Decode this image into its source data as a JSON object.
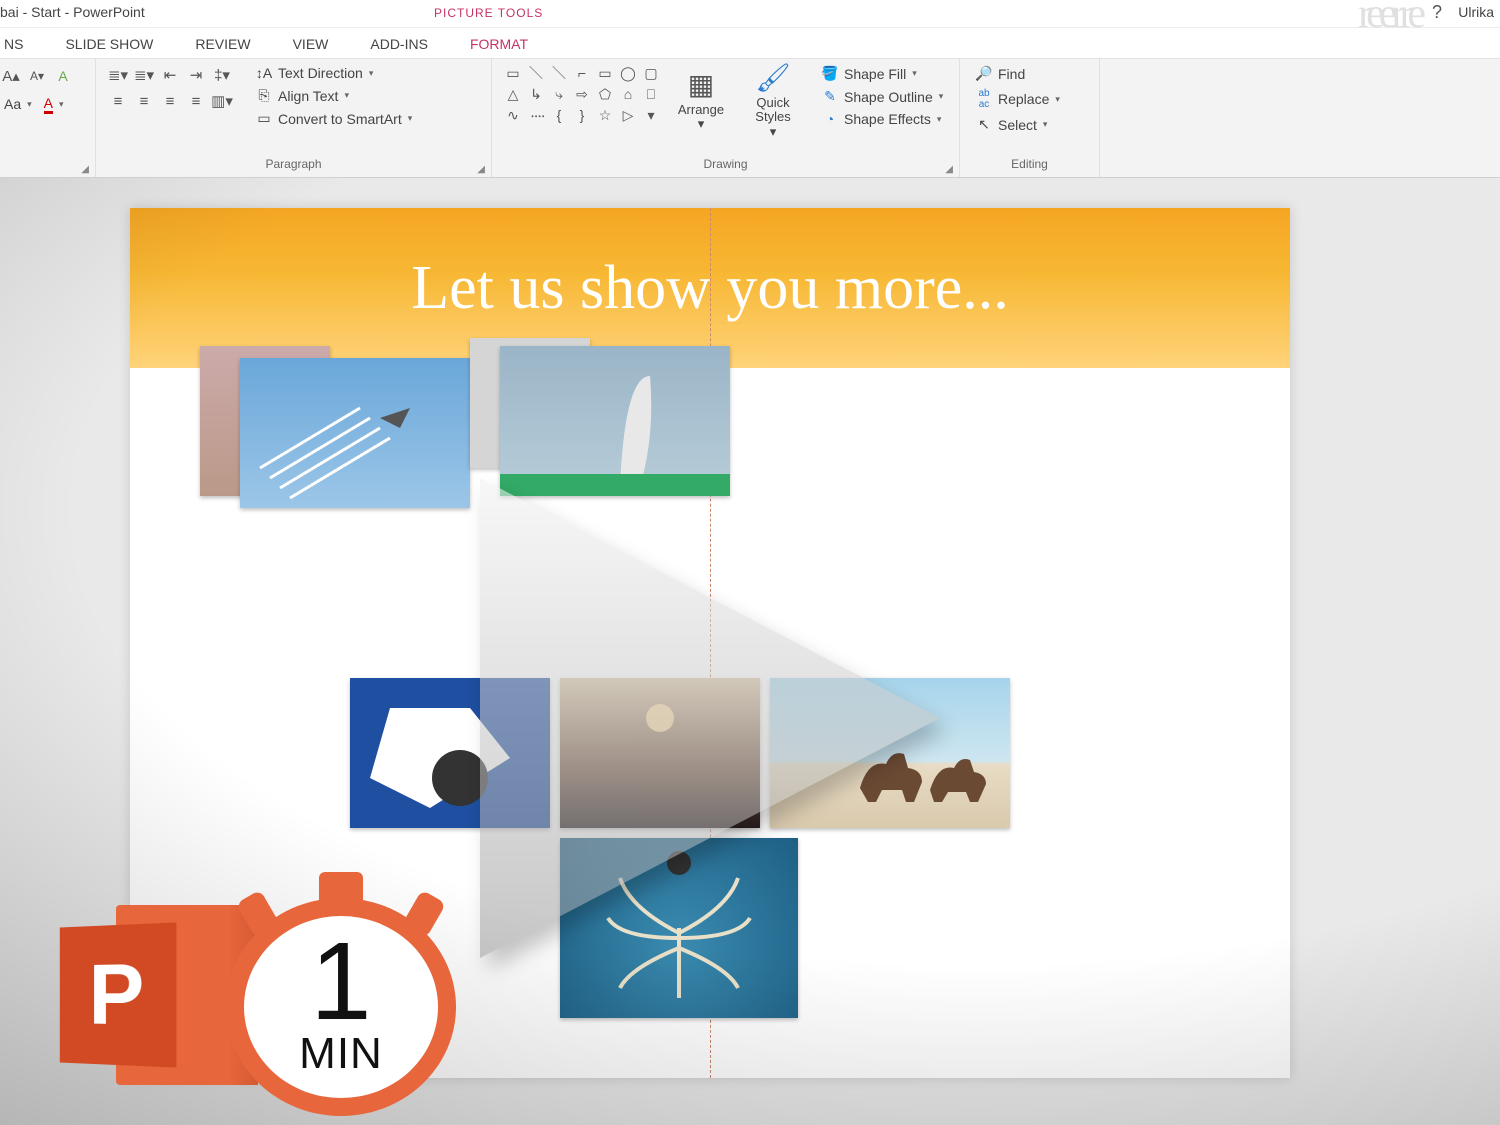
{
  "title_bar": {
    "document_title": "bai - Start - PowerPoint",
    "contextual_tab_group": "PICTURE TOOLS",
    "help_symbol": "?",
    "user_name": "Ulrika"
  },
  "tabs": {
    "items": [
      "NS",
      "SLIDE SHOW",
      "REVIEW",
      "VIEW",
      "ADD-INS",
      "FORMAT"
    ]
  },
  "ribbon": {
    "font": {
      "grow": "A",
      "shrink": "A",
      "clear": "A",
      "case": "Aa",
      "color": "A"
    },
    "paragraph": {
      "label": "Paragraph",
      "text_direction": "Text Direction",
      "align_text": "Align Text",
      "convert_smartart": "Convert to SmartArt"
    },
    "drawing": {
      "label": "Drawing",
      "arrange": "Arrange",
      "quick_styles": "Quick Styles",
      "shape_fill": "Shape Fill",
      "shape_outline": "Shape Outline",
      "shape_effects": "Shape Effects"
    },
    "editing": {
      "label": "Editing",
      "find": "Find",
      "replace": "Replace",
      "select": "Select"
    }
  },
  "slide": {
    "banner_text": "Let us show you more..."
  },
  "badge": {
    "letter": "P",
    "number": "1",
    "unit": "MIN"
  }
}
